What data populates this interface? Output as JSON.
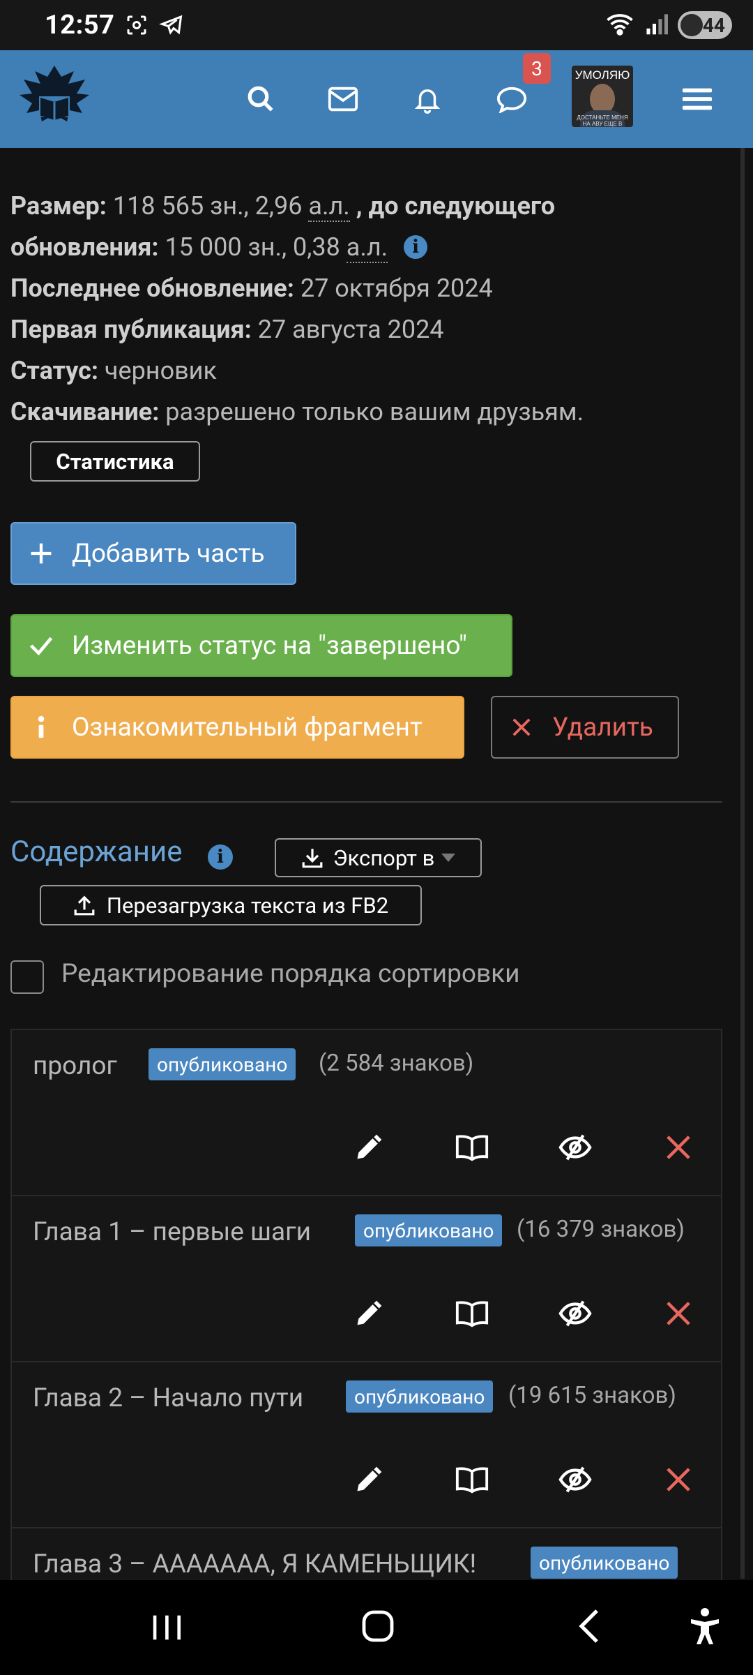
{
  "status_bar": {
    "time": "12:57",
    "battery": "44",
    "icons_left": [
      "screenshot-icon",
      "telegram-icon"
    ],
    "icons_right": [
      "wifi-icon",
      "signal-icon",
      "battery-icon"
    ]
  },
  "navbar": {
    "brand_color": "#3f7fb5",
    "messages_badge": "3",
    "avatar_caption": "УМОЛЯЮ",
    "avatar_sub": "ДОСТАНЬТЕ МЕНЯ НА АВУ ЕЩЕ В ЮЗЕРАХ ИНТЕРНЕТА"
  },
  "info": {
    "size_label": "Размер:",
    "size_value": "118 565 зн., 2,96",
    "al1": "а.л.",
    "comma": ",",
    "next_label_a": "до следующего",
    "next_label_b": "обновления:",
    "next_value": "15 000 зн., 0,38",
    "al2": "а.л.",
    "last_update_label": "Последнее обновление:",
    "last_update_value": "27 октября 2024",
    "first_pub_label": "Первая публикация:",
    "first_pub_value": "27 августа 2024",
    "status_label": "Статус:",
    "status_value": "черновик",
    "download_label": "Скачивание:",
    "download_value": "разрешено только вашим друзьям.",
    "info_icon": "i"
  },
  "buttons": {
    "statistics": "Статистика",
    "add_part": "Добавить часть",
    "change_status": "Изменить статус на \"завершено\"",
    "intro_fragment": "Ознакомительный фрагмент",
    "delete": "Удалить",
    "export": "Экспорт в",
    "reupload": "Перезагрузка текста из FB2"
  },
  "colors": {
    "primary": "#4a86c0",
    "success": "#6ab04c",
    "warning": "#f0ad4e",
    "danger": "#e8685f"
  },
  "contents": {
    "title": "Содержание",
    "info_icon": "i",
    "sort_label": "Редактирование порядка сортировки"
  },
  "chapters": [
    {
      "title": "пролог",
      "status": "опубликовано",
      "chars": "(2 584 знаков)"
    },
    {
      "title": "Глава 1 – первые шаги",
      "status": "опубликовано",
      "chars": "(16 379 знаков)"
    },
    {
      "title": "Глава 2 – Начало пути",
      "status": "опубликовано",
      "chars": "(19 615 знаков)"
    },
    {
      "title": "Глава 3 – ААААААА, Я КАМЕНЬЩИК!",
      "status": "опубликовано",
      "chars": ""
    }
  ]
}
